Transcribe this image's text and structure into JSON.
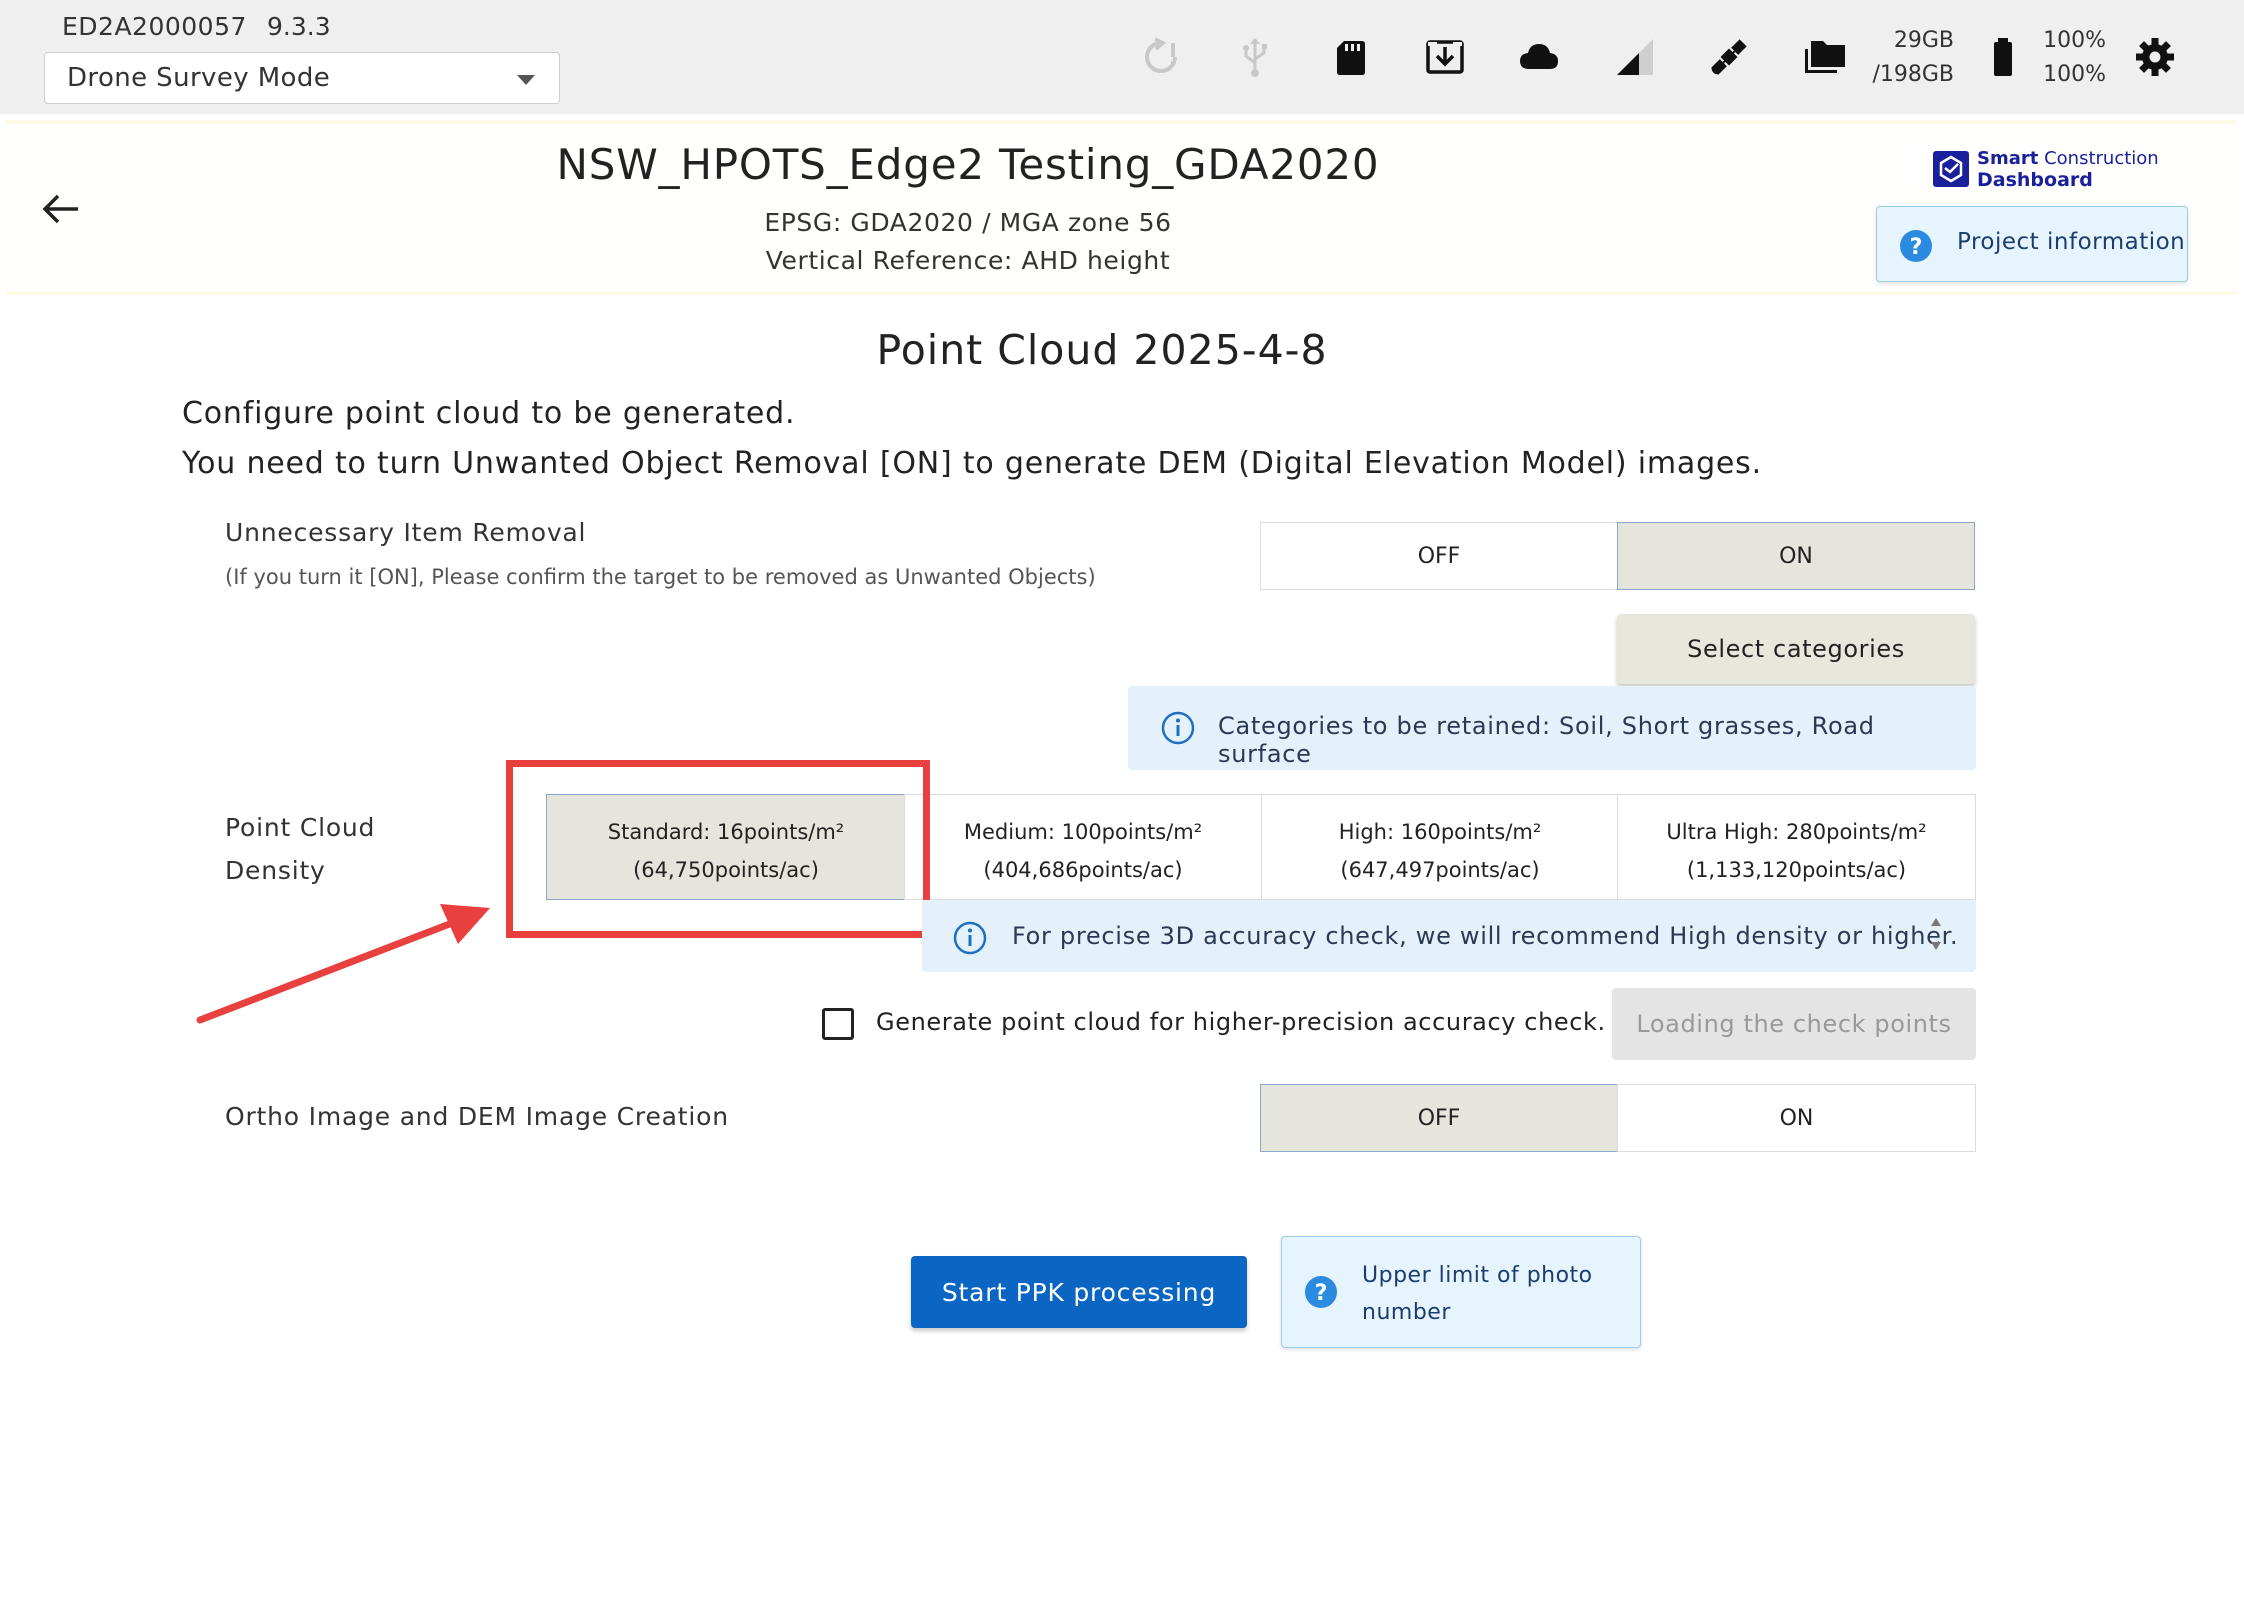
{
  "status_bar": {
    "device_id": "ED2A2000057",
    "version": "9.3.3",
    "mode_select": {
      "selected": "Drone Survey Mode"
    },
    "icons": [
      "sync-warning-icon",
      "usb-icon",
      "sd-card-icon",
      "download-icon",
      "cloud-icon",
      "signal-icon",
      "satellite-icon",
      "folder-icon",
      "battery-icon",
      "gear-icon"
    ],
    "storage_used": "29GB",
    "storage_total": "/198GB",
    "battery_1": "100%",
    "battery_2": "100%"
  },
  "project": {
    "title": "NSW_HPOTS_Edge2 Testing_GDA2020",
    "epsg": "EPSG: GDA2020 / MGA zone 56",
    "vertical_reference": "Vertical Reference: AHD height",
    "logo_line1_bold": "Smart",
    "logo_line1_light": " Construction",
    "logo_line2": "Dashboard",
    "info_button": "Project information"
  },
  "main": {
    "section_title": "Point Cloud 2025-4-8",
    "intro_line1": "Configure point cloud to be generated.",
    "intro_line2": "You need to turn Unwanted Object Removal [ON] to generate DEM (Digital Elevation Model) images.",
    "unnecessary_item_removal": {
      "label": "Unnecessary Item Removal",
      "note": "(If you turn it [ON], Please confirm the target to be removed as Unwanted Objects)",
      "off_label": "OFF",
      "on_label": "ON",
      "selected": "ON",
      "select_categories": "Select categories",
      "retained_info": "Categories to be retained: Soil, Short grasses, Road surface"
    },
    "point_cloud_density": {
      "label_line1": "Point Cloud",
      "label_line2": "Density",
      "options": [
        {
          "line1": "Standard: 16points/m²",
          "line2": "(64,750points/ac)",
          "selected": true
        },
        {
          "line1": "Medium: 100points/m²",
          "line2": "(404,686points/ac)",
          "selected": false
        },
        {
          "line1": "High: 160points/m²",
          "line2": "(647,497points/ac)",
          "selected": false
        },
        {
          "line1": "Ultra High: 280points/m²",
          "line2": "(1,133,120points/ac)",
          "selected": false
        }
      ],
      "recommendation": "For precise 3D accuracy check, we will recommend High density or higher."
    },
    "accuracy_check": {
      "checkbox_label": "Generate point cloud for higher-precision accuracy check.",
      "checked": false,
      "load_button": "Loading the check points"
    },
    "ortho_dem": {
      "label": "Ortho Image and DEM Image Creation",
      "off_label": "OFF",
      "on_label": "ON",
      "selected": "OFF"
    },
    "start_button": "Start PPK processing",
    "photo_limit_button": "Upper limit of photo number"
  },
  "colors": {
    "annotation_red": "#e8403e",
    "primary_blue": "#0b66c3",
    "selected_bg": "#e6e5dc",
    "info_bg": "#e4f0fa"
  }
}
